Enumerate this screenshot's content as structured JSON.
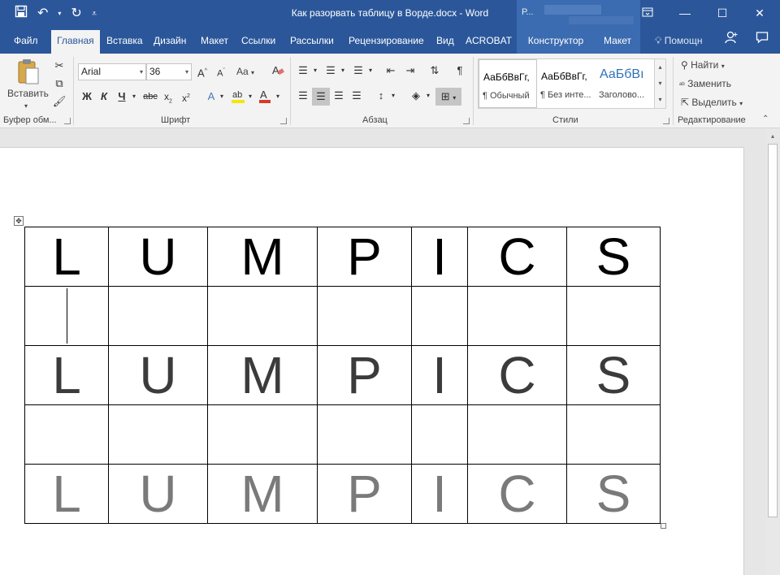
{
  "title_bar": {
    "title": "Как разорвать таблицу в Ворде.docx - Word",
    "context_label": "Р...",
    "qat_icons": [
      "save-icon",
      "undo-icon",
      "redo-icon",
      "customize-qat-icon"
    ]
  },
  "tabs": [
    {
      "label": "Файл",
      "active": false,
      "contextual": false
    },
    {
      "label": "Главная",
      "active": true,
      "contextual": false
    },
    {
      "label": "Вставка",
      "active": false,
      "contextual": false
    },
    {
      "label": "Дизайн",
      "active": false,
      "contextual": false
    },
    {
      "label": "Макет",
      "active": false,
      "contextual": false
    },
    {
      "label": "Ссылки",
      "active": false,
      "contextual": false
    },
    {
      "label": "Рассылки",
      "active": false,
      "contextual": false
    },
    {
      "label": "Рецензирование",
      "active": false,
      "contextual": false
    },
    {
      "label": "Вид",
      "active": false,
      "contextual": false
    },
    {
      "label": "ACROBAT",
      "active": false,
      "contextual": false
    },
    {
      "label": "Конструктор",
      "active": false,
      "contextual": true
    },
    {
      "label": "Макет",
      "active": false,
      "contextual": true
    }
  ],
  "help_label": "Помощн",
  "clipboard": {
    "paste_label": "Вставить",
    "group_label": "Буфер обм..."
  },
  "font": {
    "family": "Arial",
    "size": "36",
    "group_label": "Шрифт",
    "case_label": "Aa"
  },
  "paragraph": {
    "group_label": "Абзац"
  },
  "styles": {
    "group_label": "Стили",
    "items": [
      {
        "sample": "АаБбВвГг,",
        "name": "¶ Обычный"
      },
      {
        "sample": "АаБбВвГг,",
        "name": "¶ Без инте..."
      },
      {
        "sample": "АаБбВı",
        "name": "Заголово..."
      }
    ]
  },
  "editing": {
    "group_label": "Редактирование",
    "find_label": "Найти",
    "replace_label": "Заменить",
    "select_label": "Выделить"
  },
  "table": {
    "rows": [
      {
        "cells": [
          "L",
          "U",
          "M",
          "P",
          "I",
          "C",
          "S"
        ],
        "color": "#000000"
      },
      {
        "cells": [
          "",
          "",
          "",
          "",
          "",
          "",
          ""
        ],
        "color": "#000000"
      },
      {
        "cells": [
          "L",
          "U",
          "M",
          "P",
          "I",
          "C",
          "S"
        ],
        "color": "#3b3b3b"
      },
      {
        "cells": [
          "",
          "",
          "",
          "",
          "",
          "",
          ""
        ],
        "color": "#000000"
      },
      {
        "cells": [
          "L",
          "U",
          "M",
          "P",
          "I",
          "C",
          "S"
        ],
        "color": "#7a7a7a"
      }
    ]
  },
  "colors": {
    "accent": "#2b579a",
    "ribbon_bg": "#f3f3f3"
  }
}
